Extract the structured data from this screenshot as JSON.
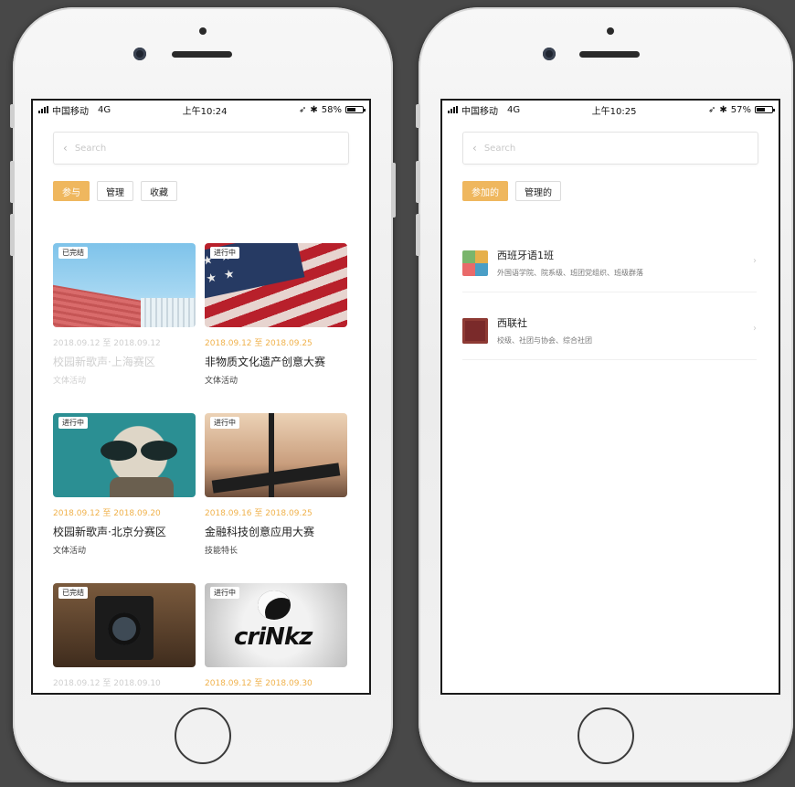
{
  "left_phone": {
    "status": {
      "carrier": "中国移动",
      "network": "4G",
      "time": "上午10:24",
      "battery": "58%",
      "battery_level": 0.58
    },
    "search": {
      "placeholder": "Search"
    },
    "tabs": [
      {
        "label": "参与",
        "active": true
      },
      {
        "label": "管理",
        "active": false
      },
      {
        "label": "收藏",
        "active": false
      }
    ],
    "cards": [
      {
        "badge": "已完结",
        "dates": "2018.09.12 至 2018.09.12",
        "title": "校园新歌声·上海赛区",
        "category": "文体活动",
        "state": "done"
      },
      {
        "badge": "进行中",
        "dates": "2018.09.12 至 2018.09.25",
        "title": "非物质文化遗产创意大赛",
        "category": "文体活动",
        "state": "ongoing"
      },
      {
        "badge": "进行中",
        "dates": "2018.09.12 至 2018.09.20",
        "title": "校园新歌声·北京分赛区",
        "category": "文体活动",
        "state": "ongoing"
      },
      {
        "badge": "进行中",
        "dates": "2018.09.16 至 2018.09.25",
        "title": "金融科技创意应用大赛",
        "category": "技能特长",
        "state": "ongoing"
      },
      {
        "badge": "已完结",
        "dates": "2018.09.12 至 2018.09.10",
        "title": "",
        "category": "",
        "state": "done"
      },
      {
        "badge": "进行中",
        "dates": "2018.09.12 至 2018.09.30",
        "title": "",
        "category": "",
        "state": "ongoing",
        "image_text": "criNkz"
      }
    ]
  },
  "right_phone": {
    "status": {
      "carrier": "中国移动",
      "network": "4G",
      "time": "上午10:25",
      "battery": "57%",
      "battery_level": 0.57
    },
    "search": {
      "placeholder": "Search"
    },
    "tabs": [
      {
        "label": "参加的",
        "active": true
      },
      {
        "label": "管理的",
        "active": false
      }
    ],
    "items": [
      {
        "name": "西班牙语1班",
        "tags": "外国语学院、院系级、班团党组织、班级群落"
      },
      {
        "name": "西联社",
        "tags": "校级、社团与协会、综合社团"
      }
    ]
  },
  "colors": {
    "accent": "#efb75e",
    "ongoing_date": "#f0b24c",
    "done_text": "#d0d0d0"
  },
  "icons": {
    "back": "chevron-left-icon",
    "chevron": "chevron-right-icon",
    "location": "location-arrow-icon",
    "bluetooth": "bluetooth-icon"
  }
}
